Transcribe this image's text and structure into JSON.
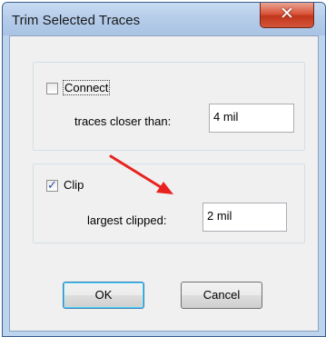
{
  "window": {
    "title": "Trim Selected Traces",
    "close_glyph": "✕"
  },
  "connect_group": {
    "checkbox_label": "Connect",
    "checked": false,
    "field_label": "traces closer than:",
    "field_value": "4 mil"
  },
  "clip_group": {
    "checkbox_label": "Clip",
    "checked": true,
    "check_glyph": "✓",
    "field_label": "largest clipped:",
    "field_value": "2 mil"
  },
  "buttons": {
    "ok": "OK",
    "cancel": "Cancel"
  },
  "annotation": {
    "arrow_color": "#e8231f"
  }
}
